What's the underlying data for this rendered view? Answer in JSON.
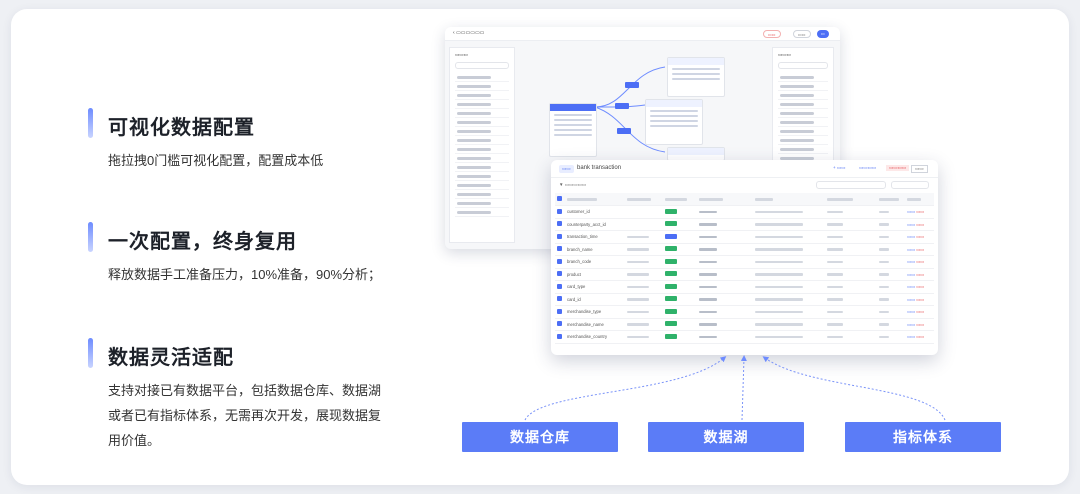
{
  "features": [
    {
      "title": "可视化数据配置",
      "desc": "拖拉拽0门槛可视化配置，配置成本低"
    },
    {
      "title": "一次配置，终身复用",
      "desc": "释放数据手工准备压力，10%准备，90%分析；"
    },
    {
      "title": "数据灵活适配",
      "desc": "支持对接已有数据平台，包括数据仓库、数据湖或者已有指标体系，无需再次开发，展现数据复用价值。"
    }
  ],
  "screenshot": {
    "front_window": {
      "title": "bank transaction",
      "rows": [
        "customer_id",
        "counterparty_acct_id",
        "transaction_time",
        "branch_name",
        "branch_code",
        "product",
        "card_type",
        "card_id",
        "merchandise_type",
        "merchandise_name",
        "merchandise_country"
      ]
    }
  },
  "targets": [
    "数据仓库",
    "数据湖",
    "指标体系"
  ],
  "colors": {
    "accent": "#5b7cf7",
    "green": "#2fb26a",
    "red": "#e5484d"
  }
}
